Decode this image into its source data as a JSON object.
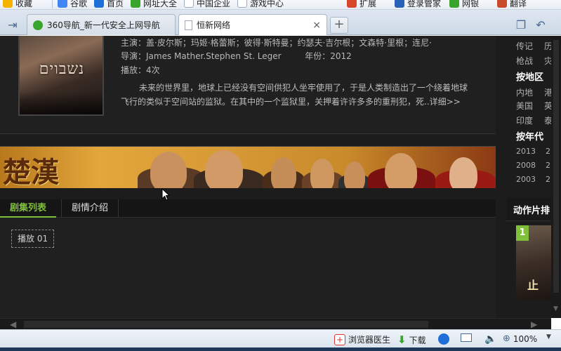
{
  "favorites": {
    "items": [
      {
        "label": "收藏",
        "icon": "star-icon",
        "color": "#f4b400"
      },
      {
        "label": "谷歌",
        "icon": "google-icon",
        "color": "#4285f4"
      },
      {
        "label": "首页",
        "icon": "ie-icon",
        "color": "#1e6fd8"
      },
      {
        "label": "网址大全",
        "icon": "360-icon",
        "color": "#3aa52c"
      },
      {
        "label": "中国企业",
        "icon": "page-icon",
        "color": "#9aa9bb"
      },
      {
        "label": "游戏中心",
        "icon": "page-icon",
        "color": "#9aa9bb"
      },
      {
        "label": "扩展",
        "icon": "extension-icon",
        "color": "#d9472b"
      },
      {
        "label": "登录管家",
        "icon": "key-icon",
        "color": "#2a62b8"
      },
      {
        "label": "网银",
        "icon": "bank-icon",
        "color": "#3aa52c"
      },
      {
        "label": "翻译",
        "icon": "translate-icon",
        "color": "#c94c2a"
      }
    ]
  },
  "tabs": [
    {
      "title": "360导航_新一代安全上网导航",
      "icon": "360-icon",
      "color": "#3aa52c"
    },
    {
      "title": "恒新网络",
      "icon": "page-icon",
      "color": "#9aa9bb"
    }
  ],
  "tab_controls": {
    "new_tab": "+"
  },
  "movie": {
    "poster_title": "נשבוים",
    "cast_label": "主演：",
    "cast": "盖·皮尔斯；玛姬·格蕾斯；彼得·斯特曼；约瑟夫·吉尔根；文森特·里根；连尼·",
    "director_label": "导演：",
    "director": "James Mather.Stephen St. Leger",
    "year_label": "年份：",
    "year": "2012",
    "plays_label": "播放：",
    "plays": "4次",
    "description": "未来的世界里，地球上已经没有空间供犯人坐牢使用了，于是人类制造出了一个绕着地球飞行的类似于空间站的监狱。在其中的一个监狱里，关押着许许多多的重刑犯，死",
    "more_label": "..详细>>"
  },
  "banner": {
    "logo_text": "楚漢"
  },
  "episode_section": {
    "tabs": [
      {
        "label": "剧集列表",
        "active": true
      },
      {
        "label": "剧情介绍",
        "active": false
      }
    ],
    "episodes": [
      {
        "label": "播放 01"
      }
    ]
  },
  "sidebar": {
    "genre_rows": [
      {
        "a": "传记",
        "b": "历"
      },
      {
        "a": "枪战",
        "b": "灾"
      }
    ],
    "region_header": "按地区",
    "region_rows": [
      {
        "a": "内地",
        "b": "港"
      },
      {
        "a": "美国",
        "b": "英"
      },
      {
        "a": "印度",
        "b": "泰"
      }
    ],
    "year_header": "按年代",
    "year_rows": [
      {
        "a": "2013",
        "b": "2"
      },
      {
        "a": "2008",
        "b": "2"
      },
      {
        "a": "2003",
        "b": "2"
      }
    ],
    "ranking_title": "动作片排",
    "ranking": [
      {
        "rank": "1",
        "thumb_text": "止"
      }
    ]
  },
  "statusbar": {
    "doctor": "浏览器医生",
    "download": "下载",
    "zoom": "100%"
  },
  "colors": {
    "page_bg": "#1c1c1c",
    "accent_green": "#7fbf3a",
    "text_gray": "#b8b8b8"
  }
}
